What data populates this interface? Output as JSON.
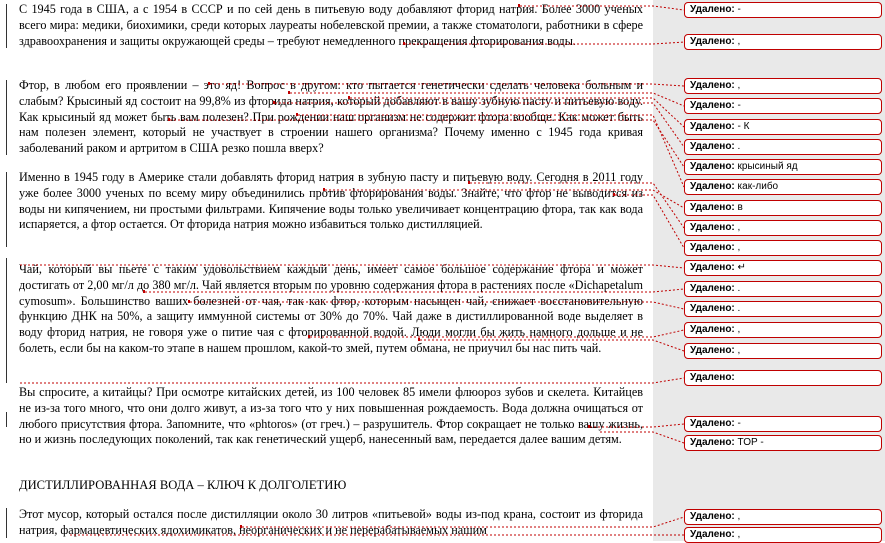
{
  "document": {
    "paragraphs": [
      {
        "text": "С 1945 года в США, а с 1954 в СССР и по сей день в питьевую воду добавляют фторид натрия. Более 3000 ученых всего мира: медики, биохимики, среди которых лауреаты нобелевской премии, а также стоматологи, работники в сфере здравоохранения и защиты окружающей среды – требуют немедленного прекращения фторирования воды."
      },
      {
        "text": "Фтор, в любом его проявлении – это яд! Вопрос в другом: кто пытается генетически сделать человека больным и слабым? Крысиный яд состоит на 99,8% из фторида натрия, который добавляют в вашу зубную пасту и питьевую воду. Как крысиный яд может быть вам полезен? При рождении наш организм не содержит фтора вообще. Как может быть нам полезен элемент, который не участвует в строении нашего организма? Почему именно с 1945 года кривая заболеваний раком и артритом в США резко пошла вверх?"
      },
      {
        "text": "Именно в 1945 году в Америке стали добавлять фторид натрия в зубную пасту и питьевую воду. Сегодня в 2011 году уже более 3000 ученых по всему миру объединились против фторирования воды. Знайте, что фтор не выводится из воды ни кипячением, ни простыми фильтрами. Кипячение воды только увеличивает концентрацию фтора, так как вода испаряется, а фтор остается. От фторида натрия можно избавиться только дистилляцией."
      },
      {
        "text": "Чай, который вы пьете с таким удовольствием каждый день, имеет самое большое содержание фтора и может достигать от 2,00 мг/л до 380 мг/л. Чай является вторым по уровню содержания фтора в растениях после «Dichapetalum cymosum». Большинство ваших болезней от чая, так как фтор, которым насыщен чай, снижает восстановительную функцию ДНК на 50%, а защиту иммунной системы от 30% до 70%. Чай даже в дистиллированной воде выделяет в воду фторид натрия, не говоря уже о питие чая с фторированной водой. Люди могли бы жить намного дольше и не болеть, если бы на каком-то этапе в нашем прошлом, какой-то змей, путем обмана, не приучил бы нас пить чай."
      },
      {
        "text": "Вы спросите, а китайцы? При осмотре китайских детей, из 100 человек 85 имели флюороз зубов и скелета. Китайцев не из-за того много, что они долго живут, а из-за того что у них повышенная рождаемость. Вода должна очищаться от любого присутствия фтора. Запомните, что «phtoros» (от греч.) – разрушитель. Фтор сокращает не только вашу жизнь, но и жизнь последующих поколений, так как генетический ущерб, нанесенный вам, передается далее вашим детям."
      },
      {
        "text": "Этот мусор, который остался после дистилляции около 30 литров «питьевой» воды из-под крана, состоит из фторида натрия, фармацевтических ядохимикатов, неорганических и не перерабатываемых нашим"
      }
    ],
    "heading": "ДИСТИЛЛИРОВАННАЯ  ВОДА – КЛЮЧ К ДОЛГОЛЕТИЮ"
  },
  "comments": [
    {
      "label": "Удалено:",
      "value": "-"
    },
    {
      "label": "Удалено:",
      "value": ","
    },
    {
      "label": "Удалено:",
      "value": ","
    },
    {
      "label": "Удалено:",
      "value": "-"
    },
    {
      "label": "Удалено:",
      "value": "- К"
    },
    {
      "label": "Удалено:",
      "value": "."
    },
    {
      "label": "Удалено:",
      "value": "крысиный яд"
    },
    {
      "label": "Удалено:",
      "value": "как-либо"
    },
    {
      "label": "Удалено:",
      "value": "в"
    },
    {
      "label": "Удалено:",
      "value": ","
    },
    {
      "label": "Удалено:",
      "value": ","
    },
    {
      "label": "Удалено:",
      "value": "↵"
    },
    {
      "label": "Удалено:",
      "value": "."
    },
    {
      "label": "Удалено:",
      "value": "."
    },
    {
      "label": "Удалено:",
      "value": ","
    },
    {
      "label": "Удалено:",
      "value": ","
    },
    {
      "label": "Удалено:",
      "value": ""
    },
    {
      "label": "Удалено:",
      "value": "-"
    },
    {
      "label": "Удалено:",
      "value": "ТОР -"
    },
    {
      "label": "Удалено:",
      "value": ","
    },
    {
      "label": "Удалено:",
      "value": ","
    }
  ],
  "colors": {
    "balloon_border": "#c00000",
    "leader": "#c00000",
    "margin_bg": "#e9e9e9"
  }
}
